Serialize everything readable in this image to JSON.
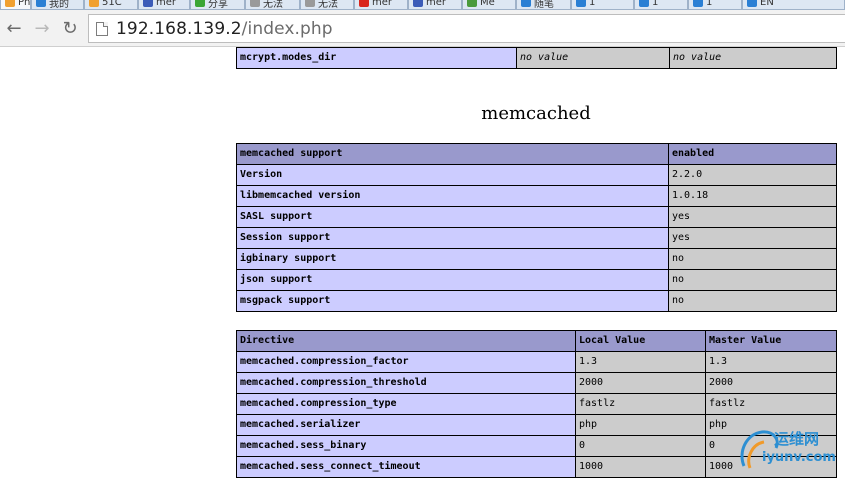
{
  "browser": {
    "tabs": [
      {
        "label": "Ph",
        "color": "#f0a030",
        "active": true,
        "closable": true
      },
      {
        "label": "我的",
        "color": "#2a7fd4"
      },
      {
        "label": "51C",
        "color": "#f0a030"
      },
      {
        "label": "mer",
        "color": "#3b5bb8"
      },
      {
        "label": "分享",
        "color": "#3aa535"
      },
      {
        "label": "无法",
        "color": "#9a9a9a"
      },
      {
        "label": "无法",
        "color": "#9a9a9a"
      },
      {
        "label": "mer",
        "color": "#d9251c"
      },
      {
        "label": "mer",
        "color": "#3b5bb8"
      },
      {
        "label": "Me",
        "color": "#4a9a3c"
      },
      {
        "label": "随笔",
        "color": "#2a7fd4"
      },
      {
        "label": "1",
        "color": "#2a7fd4"
      },
      {
        "label": "1",
        "color": "#2a7fd4"
      },
      {
        "label": "1",
        "color": "#2a7fd4"
      },
      {
        "label": "EN",
        "color": "#2a7fd4"
      }
    ],
    "nav": {
      "back_glyph": "←",
      "forward_glyph": "→",
      "reload_glyph": "↻"
    },
    "url_host": "192.168.139.2",
    "url_path": "/index.php"
  },
  "top_row": {
    "name": "mcrypt.modes_dir",
    "local": "no value",
    "master": "no value"
  },
  "section_title": "memcached",
  "support_table": {
    "header": [
      "memcached support",
      "enabled"
    ],
    "rows": [
      [
        "Version",
        "2.2.0"
      ],
      [
        "libmemcached version",
        "1.0.18"
      ],
      [
        "SASL support",
        "yes"
      ],
      [
        "Session support",
        "yes"
      ],
      [
        "igbinary support",
        "no"
      ],
      [
        "json support",
        "no"
      ],
      [
        "msgpack support",
        "no"
      ]
    ]
  },
  "directive_table": {
    "header": [
      "Directive",
      "Local Value",
      "Master Value"
    ],
    "rows": [
      [
        "memcached.compression_factor",
        "1.3",
        "1.3"
      ],
      [
        "memcached.compression_threshold",
        "2000",
        "2000"
      ],
      [
        "memcached.compression_type",
        "fastlz",
        "fastlz"
      ],
      [
        "memcached.serializer",
        "php",
        "php"
      ],
      [
        "memcached.sess_binary",
        "0",
        "0"
      ],
      [
        "memcached.sess_connect_timeout",
        "1000",
        "1000"
      ]
    ]
  },
  "watermark": {
    "text_cn": "运维网",
    "text_en": "iyunv.com"
  }
}
